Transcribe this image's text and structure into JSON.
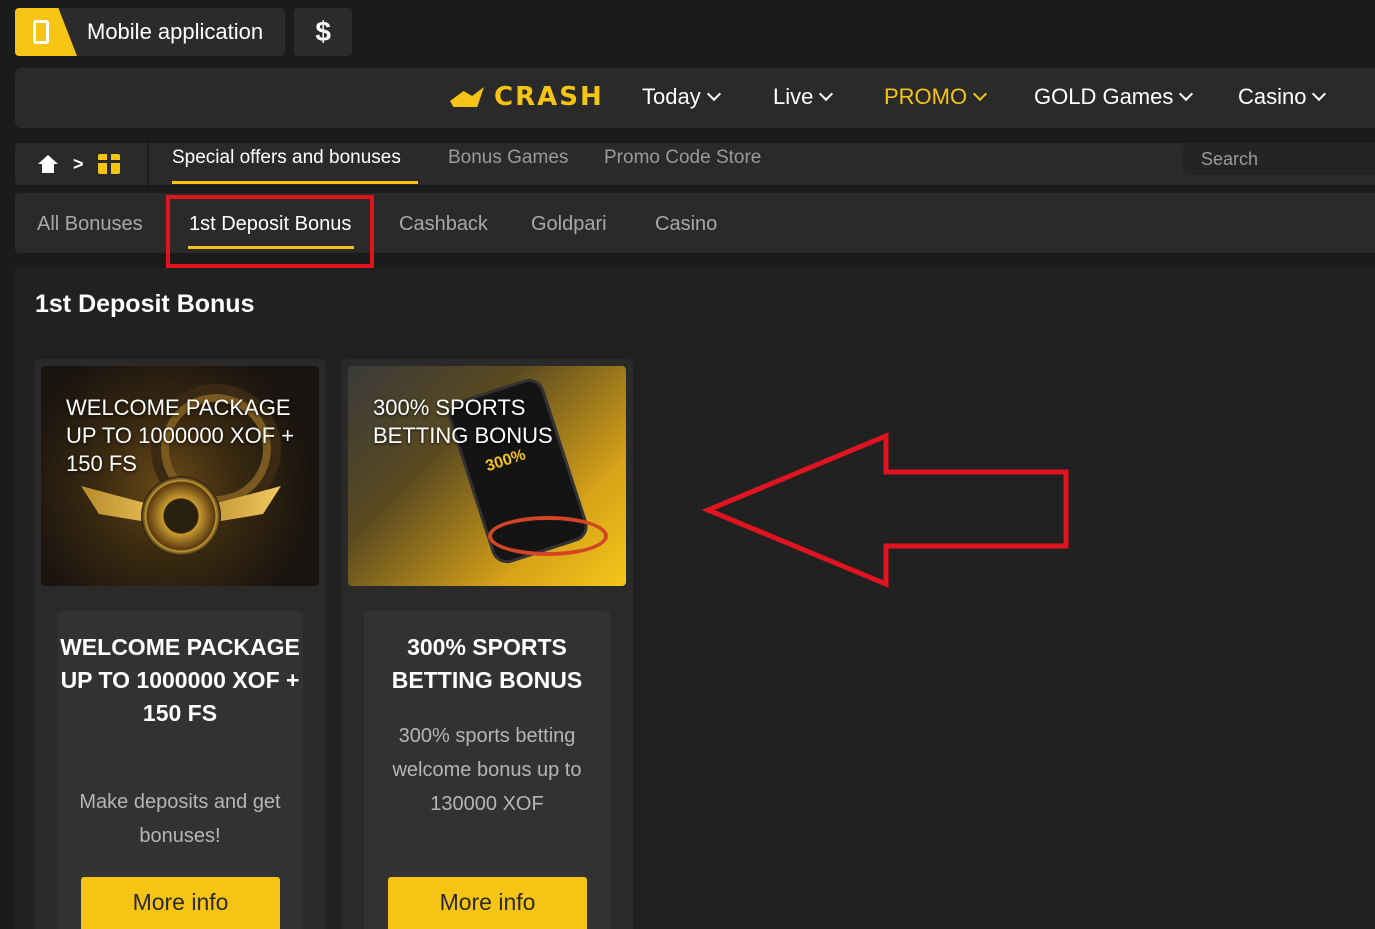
{
  "topbar": {
    "mobile_label": "Mobile application",
    "currency_symbol": "$"
  },
  "nav": {
    "brand": "CRASH",
    "items": [
      {
        "label": "Today"
      },
      {
        "label": "Live"
      },
      {
        "label": "PROMO"
      },
      {
        "label": "GOLD Games"
      },
      {
        "label": "Casino"
      }
    ]
  },
  "subnav": {
    "breadcrumb_separator": ">",
    "tabs": [
      {
        "label": "Special offers and bonuses"
      },
      {
        "label": "Bonus Games"
      },
      {
        "label": "Promo Code Store"
      }
    ],
    "search_placeholder": "Search"
  },
  "filters": [
    {
      "label": "All Bonuses"
    },
    {
      "label": "1st Deposit Bonus"
    },
    {
      "label": "Cashback"
    },
    {
      "label": "Goldpari"
    },
    {
      "label": "Casino"
    }
  ],
  "section_title": "1st Deposit Bonus",
  "cards": [
    {
      "image_title": "WELCOME PACKAGE UP TO 1000000 XOF + 150 FS",
      "title": "WELCOME PACKAGE UP TO 1000000 XOF + 150 FS",
      "description": "Make deposits and get bonuses!",
      "button": "More info"
    },
    {
      "image_title": "300% SPORTS BETTING BONUS",
      "title": "300% SPORTS BETTING BONUS",
      "description": "300% sports betting welcome bonus up to 130000 XOF",
      "button": "More info",
      "image_badge": "300%"
    }
  ],
  "colors": {
    "accent": "#f5c414",
    "annotation_red": "#e0141e",
    "background": "#1b1b1b",
    "panel": "#2a2a2a"
  }
}
